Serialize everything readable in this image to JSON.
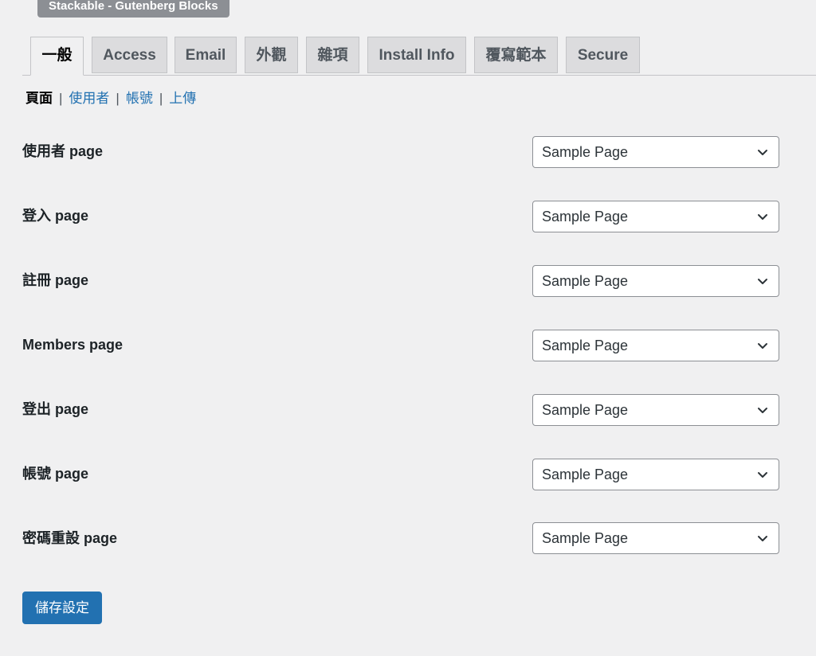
{
  "plugin_badge": "Stackable - Gutenberg Blocks",
  "tabs": [
    {
      "label": "一般",
      "active": true
    },
    {
      "label": "Access",
      "active": false
    },
    {
      "label": "Email",
      "active": false
    },
    {
      "label": "外觀",
      "active": false
    },
    {
      "label": "雜項",
      "active": false
    },
    {
      "label": "Install Info",
      "active": false
    },
    {
      "label": "覆寫範本",
      "active": false
    },
    {
      "label": "Secure",
      "active": false
    }
  ],
  "subnav": {
    "current": "頁面",
    "separator": "|",
    "links": [
      "使用者",
      "帳號",
      "上傳"
    ]
  },
  "settings_rows": [
    {
      "label": "使用者 page",
      "value": "Sample Page"
    },
    {
      "label": "登入 page",
      "value": "Sample Page"
    },
    {
      "label": "註冊 page",
      "value": "Sample Page"
    },
    {
      "label": "Members page",
      "value": "Sample Page"
    },
    {
      "label": "登出 page",
      "value": "Sample Page"
    },
    {
      "label": "帳號 page",
      "value": "Sample Page"
    },
    {
      "label": "密碼重設 page",
      "value": "Sample Page"
    }
  ],
  "save_button_label": "儲存設定",
  "colors": {
    "background": "#f0f0f1",
    "accent": "#2271b1",
    "badge": "#8c8f94"
  }
}
